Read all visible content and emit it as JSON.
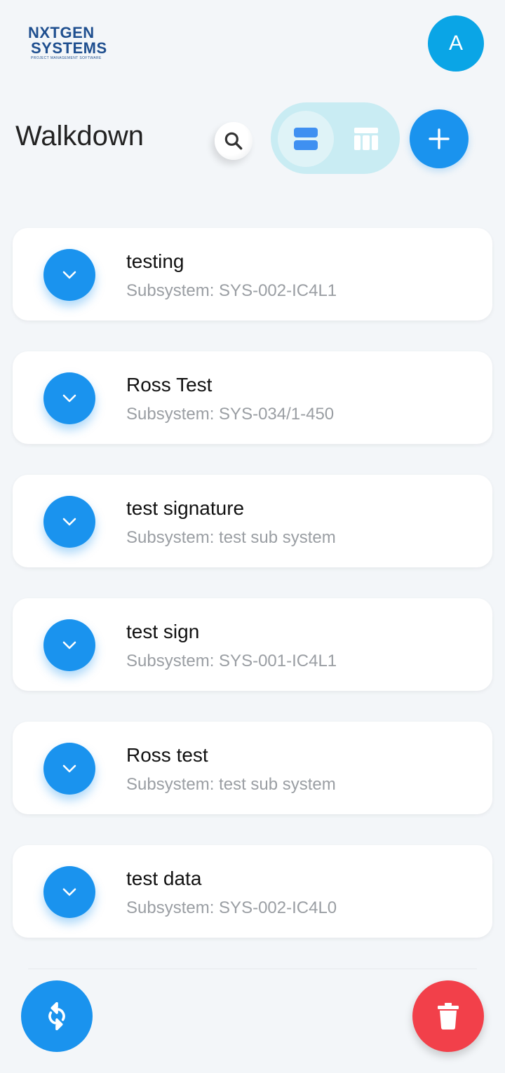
{
  "header": {
    "logo": {
      "line1": "NXTGEN",
      "line2": "SYSTEMS",
      "tagline": "PROJECT MANAGEMENT SOFTWARE"
    },
    "avatar_initial": "A"
  },
  "toolbar": {
    "title": "Walkdown",
    "search_icon": "search-icon",
    "view_list_icon": "view-list-icon",
    "view_table_icon": "view-table-icon",
    "add_icon": "plus-icon",
    "active_view": "list"
  },
  "walkdowns": [
    {
      "title": "testing",
      "subsystem": "Subsystem: SYS-002-IC4L1"
    },
    {
      "title": "Ross Test",
      "subsystem": "Subsystem: SYS-034/1-450"
    },
    {
      "title": "test signature",
      "subsystem": "Subsystem: test sub system"
    },
    {
      "title": "test sign",
      "subsystem": "Subsystem: SYS-001-IC4L1"
    },
    {
      "title": "Ross test",
      "subsystem": "Subsystem: test sub system"
    },
    {
      "title": "test data",
      "subsystem": "Subsystem: SYS-002-IC4L0"
    }
  ],
  "footer": {
    "sync_icon": "sync-icon",
    "delete_icon": "trash-icon"
  },
  "colors": {
    "primary": "#1a93ee",
    "avatar": "#0aa5e6",
    "danger": "#f2404a",
    "toggle_bg": "#c9ecf3",
    "background": "#f3f6f9"
  }
}
